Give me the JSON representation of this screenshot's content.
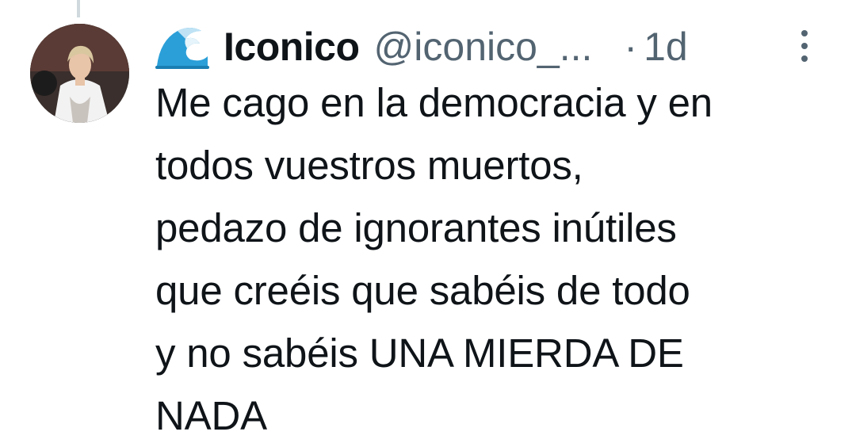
{
  "tweet": {
    "author": {
      "display_name": "Iconico",
      "handle": "@iconico_...",
      "badge_icon": "wave-icon"
    },
    "separator": "·",
    "time": "1d",
    "menu_icon": "more-vertical-icon",
    "text": "Me cago en la democracia y en\ntodos vuestros muertos,\npedazo de ignorantes inútiles\nque creéis que sabéis de todo\ny no sabéis UNA MIERDA DE\nNADA"
  },
  "colors": {
    "text_primary": "#0f1419",
    "text_secondary": "#536471",
    "thread_line": "#cfd9de",
    "wave_blue": "#2b9fd8"
  }
}
